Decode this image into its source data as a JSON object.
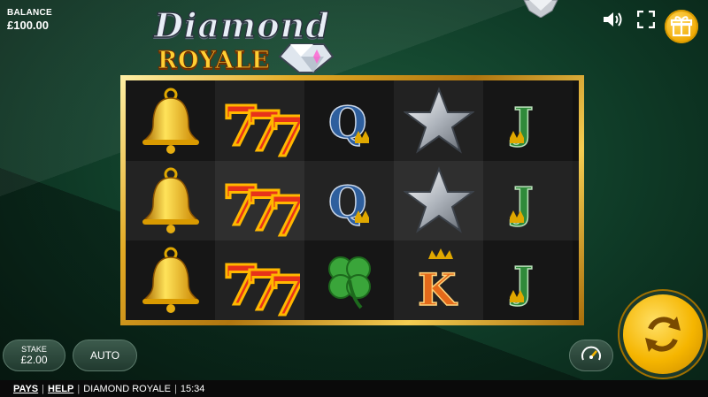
{
  "balance": {
    "label": "BALANCE",
    "value": "£100.00"
  },
  "logo": {
    "line1": "Diamond",
    "line2": "ROYALE"
  },
  "controls": {
    "stake_label": "STAKE",
    "stake_value": "£2.00",
    "auto_label": "AUTO"
  },
  "footer": {
    "pays": "PAYS",
    "help": "HELP",
    "game_name": "DIAMOND ROYALE",
    "time": "15:34",
    "divider": "|"
  },
  "reels": [
    [
      "bell",
      "bell",
      "bell"
    ],
    [
      "seven",
      "seven",
      "seven"
    ],
    [
      "queen",
      "queen",
      "clover"
    ],
    [
      "star",
      "star",
      "king"
    ],
    [
      "jack",
      "jack",
      "jack"
    ]
  ],
  "icons": {
    "sound": "speaker-icon",
    "fullscreen": "fullscreen-icon",
    "gift": "gift-icon",
    "spin": "spin-arrows-icon",
    "turbo": "turbo-gauge-icon"
  },
  "colors": {
    "accent_gold": "#f5b500",
    "felt_green": "#0f3a26"
  }
}
